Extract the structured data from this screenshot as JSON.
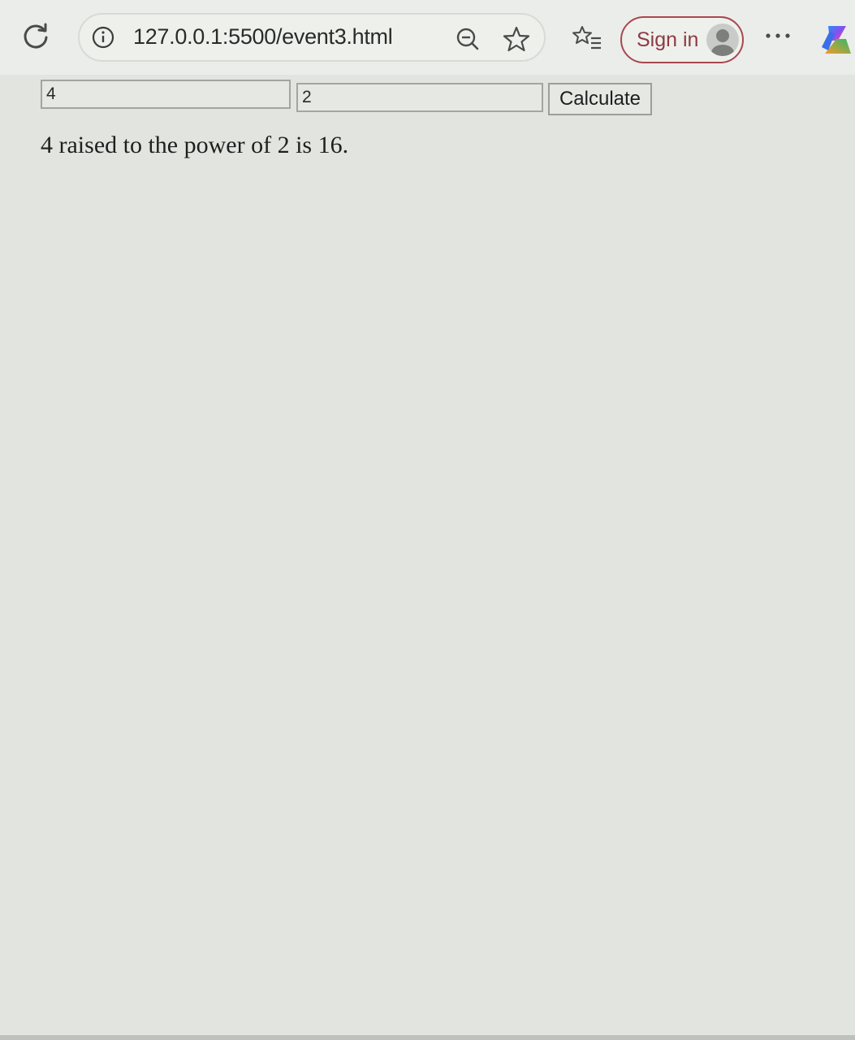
{
  "browser": {
    "url": "127.0.0.1:5500/event3.html",
    "sign_in_label": "Sign in",
    "icons": [
      "reload-icon",
      "site-info-icon",
      "zoom-icon",
      "favorite-star-icon",
      "favorites-list-icon",
      "avatar-icon",
      "more-icon",
      "copilot-icon"
    ]
  },
  "page": {
    "base_value": "4",
    "exponent_value": "2",
    "calculate_label": "Calculate",
    "result_text": "4 raised to the power of 2 is 16."
  }
}
